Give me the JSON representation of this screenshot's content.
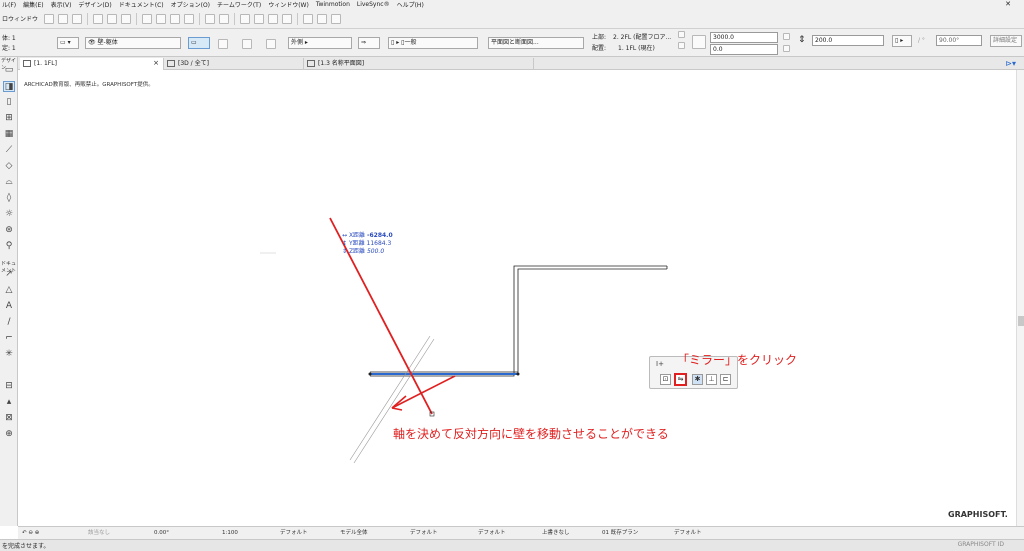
{
  "menubar": {
    "items": [
      "ル(F)",
      "編集(E)",
      "表示(V)",
      "デザイン(D)",
      "ドキュメント(C)",
      "オプション(O)",
      "チームワーク(T)",
      "ウィンドウ(W)",
      "Twinmotion",
      "LiveSync®",
      "ヘルプ(H)"
    ],
    "close": "✕"
  },
  "toolbar1": {
    "label": "ロウィンドウ"
  },
  "toolbar2": {
    "left_top": "体: 1",
    "left_bottom": "定: 1",
    "layer": "壁-躯体",
    "exterior": "外側",
    "structure": "一般",
    "display": "平面図と断面図...",
    "top_label": "上部:",
    "top_value": "2. 2FL (配置フロア...",
    "base_label": "配置:",
    "base_value": "1. 1FL (現在)",
    "height_value": "3000.0",
    "offset_value": "0.0",
    "thickness_value": "200.0",
    "angle_value": "90.00°",
    "right_button": "詳細設定"
  },
  "tabs": [
    {
      "label": "[1. 1FL]",
      "close": "×"
    },
    {
      "label": "[3D / 全て]",
      "close": ""
    },
    {
      "label": "[1.3 名称平面図]",
      "close": ""
    }
  ],
  "sidebar": {
    "label1": "デザイン",
    "label2": "ドキュメント"
  },
  "canvas": {
    "copyright": "ARCHICAD教育版、再販禁止。GRAPHISOFT提供。",
    "tracker": {
      "x_label": "X距離",
      "x_value": "-6284.0",
      "y_label": "Y距離",
      "y_value": "11684.3",
      "z_label": "Z距離",
      "z_value": "500.0"
    },
    "popup_title": "I+",
    "annotation_mirror": "「ミラー」をクリック",
    "annotation_desc": "軸を決めて反対方向に壁を移動させることができる",
    "logo": "GRAPHISOFT."
  },
  "statusbar": {
    "zoom_label": "該当なし",
    "angle": "0.00°",
    "scale": "1:100",
    "pen1": "デフォルト",
    "model": "モデル全体",
    "pen2": "デフォルト",
    "pen3": "デフォルト",
    "override": "上書きなし",
    "plan": "01 既存プラン",
    "pen4": "デフォルト"
  },
  "bottombar": {
    "message": "を完成させます。",
    "brand": "GRAPHISOFT ID"
  },
  "colors": {
    "annotation": "#e02020",
    "wall_selected": "#2a6ad0",
    "tracker": "#2a4bbf"
  }
}
